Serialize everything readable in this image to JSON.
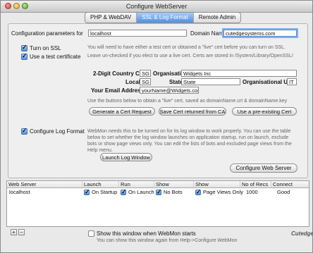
{
  "window": {
    "title": "Configure WebServer"
  },
  "tabs": [
    {
      "label": "PHP & WebDAV",
      "active": false
    },
    {
      "label": "SSL & Log Format",
      "active": true
    },
    {
      "label": "Remote Admin",
      "active": false
    }
  ],
  "config": {
    "params_label": "Configuration parameters for",
    "params_value": "localhost",
    "domain_label": "Domain Name",
    "domain_value": "cutedgesystems.com"
  },
  "ssl": {
    "turn_on_label": "Turn on SSL",
    "turn_on_checked": true,
    "turn_on_note": "You will need to have either a test cert or obtained a \"live\" cert before you can turn on SSL.",
    "test_cert_label": "Use a test certificate",
    "test_cert_checked": true,
    "test_cert_note": "Leave un-checked if you elect to use a live cert. Certs are stored in /System/Library/OpenSSL/"
  },
  "cert": {
    "country_label": "2-Digit Country Code",
    "country_value": "SG",
    "org_label": "Organisation",
    "org_value": "Widgets Inc",
    "locality_label": "Locality",
    "locality_value": "SG",
    "state_label": "State",
    "state_value": "State",
    "org_unit_label": "Organisational Unit",
    "org_unit_value": "IT",
    "email_label": "Your Email Address",
    "email_value": "yourName@Widgets.com",
    "live_note": "Use the buttons below to obtain a \"live\" cert, saved as domainName.crt & domainName.key",
    "generate_btn": "Generate a Cert Request",
    "save_btn": "Save Cert returned from CA",
    "preexisting_btn": "Use a pre-existing Cert"
  },
  "log": {
    "configure_label": "Configure Log Format",
    "configure_checked": true,
    "note": "WebMon needs this to be turned on for its log window to work properly. You can use the table below to set whether the log window launches on application startup, run on launch, exclude bots or show page views only. You can edit the lists of bots and excluded page views from the Help menu.",
    "launch_btn": "Launch Log Window"
  },
  "configure_btn": "Configure Web Server",
  "table": {
    "headers": [
      "Web Server",
      "Launch",
      "Run",
      "Show",
      "Show",
      "No of Recs",
      "Connect"
    ],
    "rows": [
      {
        "server": "localhost",
        "launch": "On Startup",
        "launch_checked": true,
        "run": "On Launch",
        "run_checked": true,
        "bots": "No Bots",
        "bots_checked": true,
        "pages": "Page Views Only",
        "pages_checked": true,
        "recs": "1000",
        "connect": "Good"
      }
    ]
  },
  "footer": {
    "add": "+",
    "remove": "−",
    "show_label": "Show this window when WebMon starts",
    "show_checked": false,
    "hint": "You can show this window again from Help->Configure WebMon",
    "logo": "Cutedge"
  }
}
